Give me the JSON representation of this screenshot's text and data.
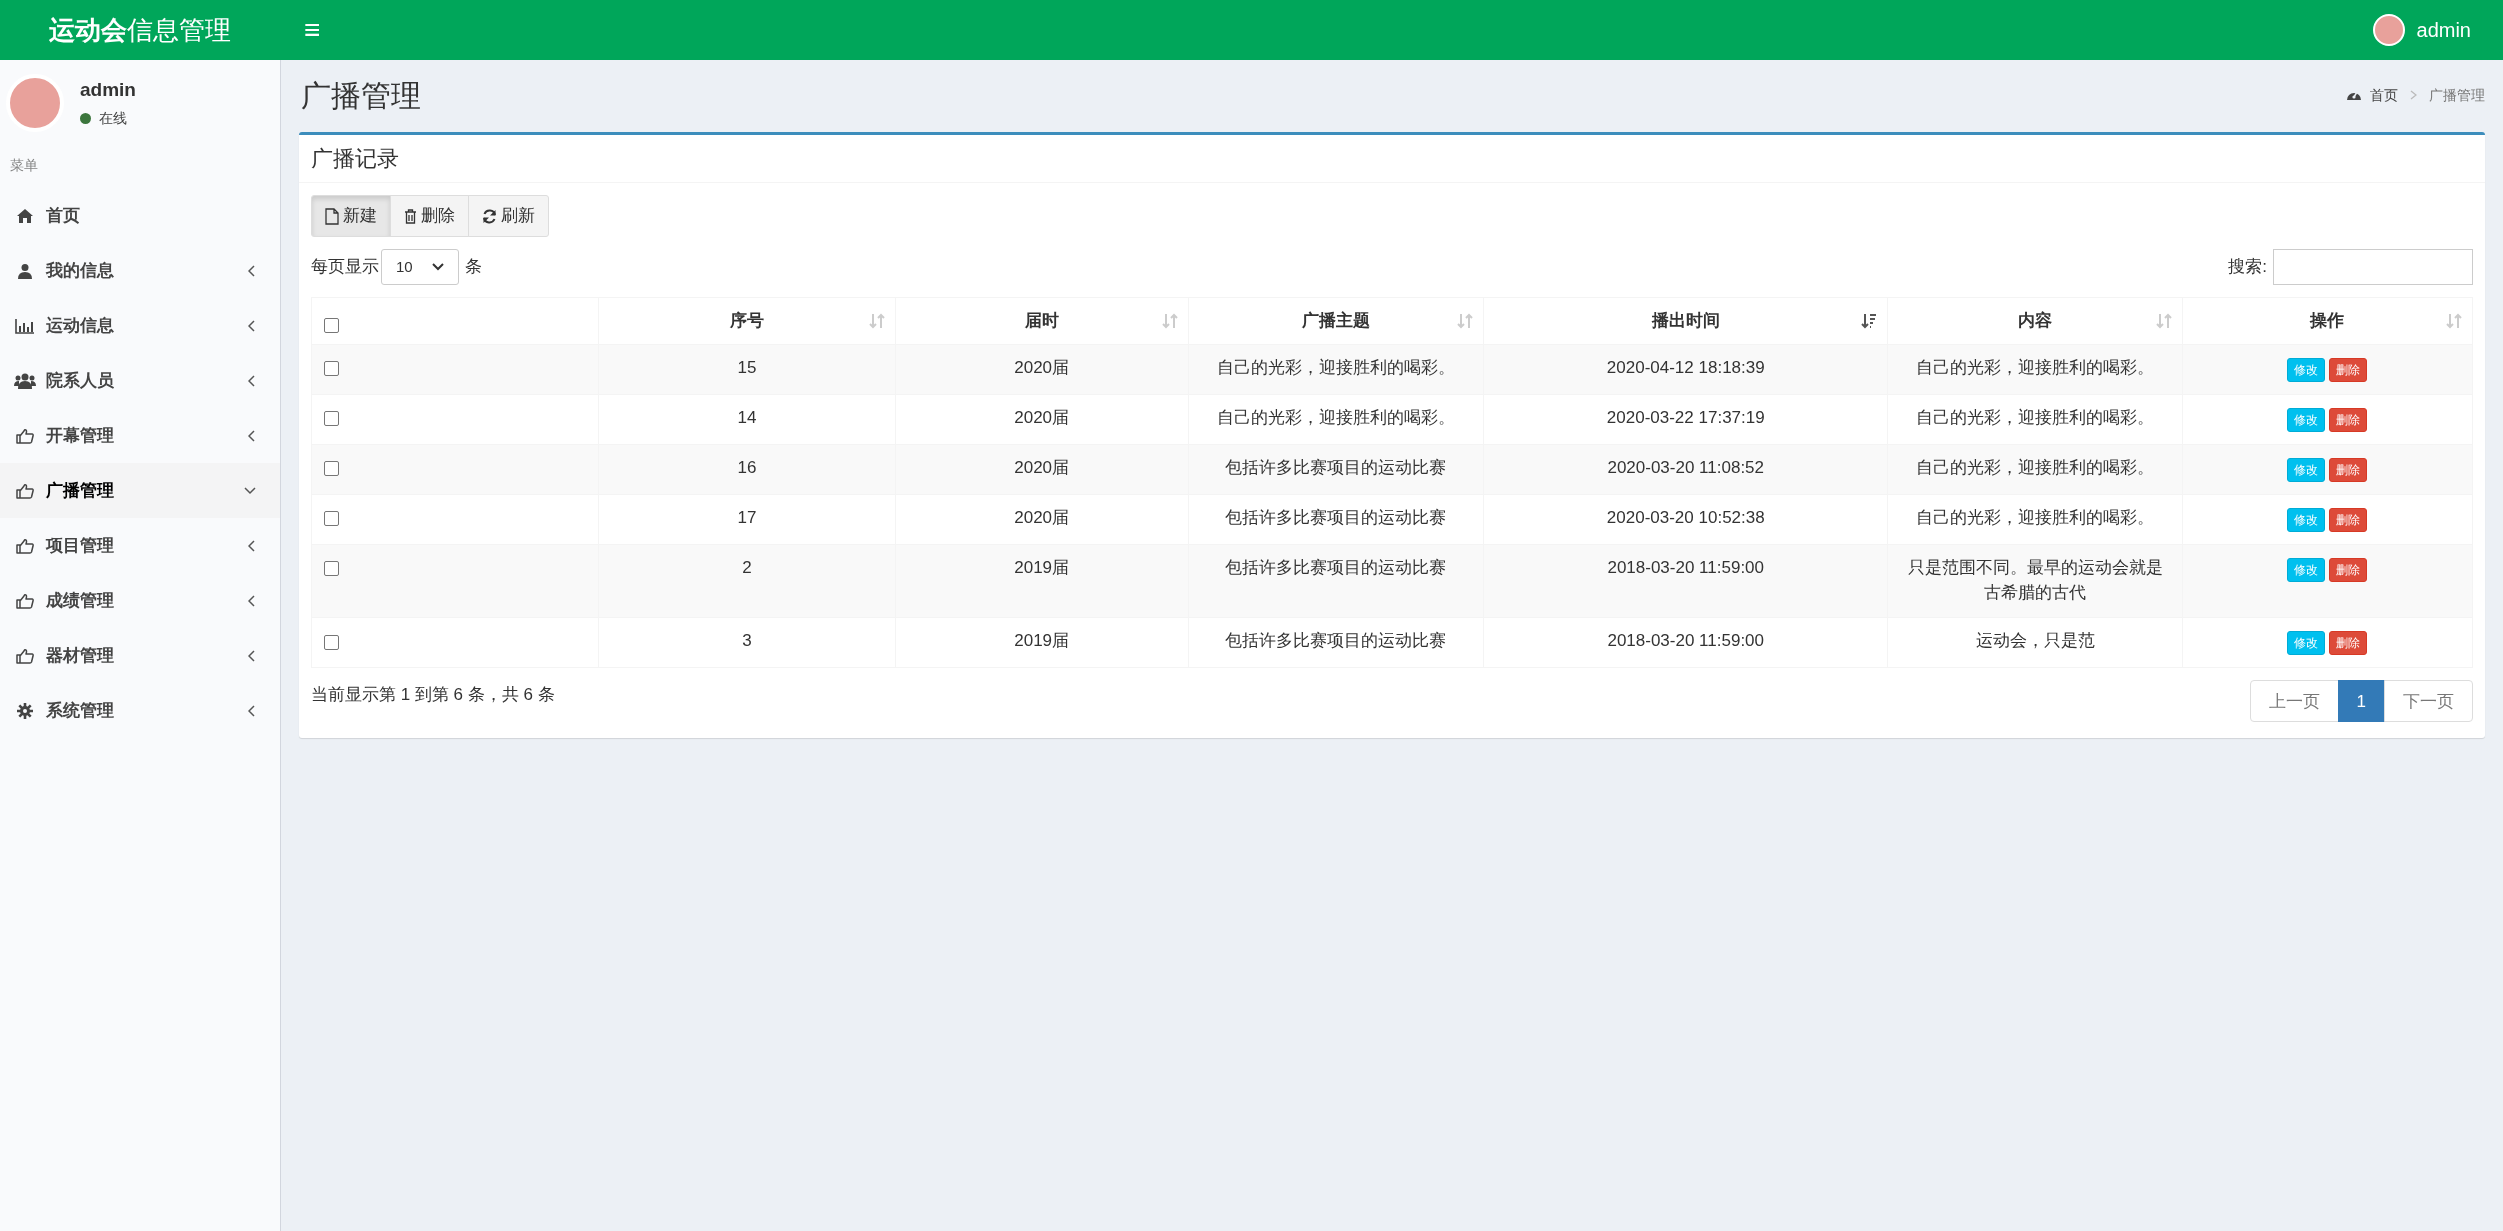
{
  "header": {
    "logo": "**运动会**信息管理",
    "menu_toggle": "≡",
    "user": "admin"
  },
  "sidebar": {
    "user": {
      "name": "admin",
      "status": "在线"
    },
    "section": "菜单",
    "items": [
      {
        "label": "首页",
        "selected": false
      },
      {
        "label": "我的信息",
        "selected": false,
        "expanded": false
      },
      {
        "label": "运动信息",
        "selected": false,
        "expanded": false
      },
      {
        "label": "院系人员",
        "selected": false,
        "expanded": false
      },
      {
        "label": "开幕管理",
        "selected": false,
        "expanded": false
      },
      {
        "label": "广播管理",
        "selected": true,
        "expanded": true
      },
      {
        "label": "项目管理",
        "selected": false,
        "expanded": false
      },
      {
        "label": "成绩管理",
        "selected": false,
        "expanded": false
      },
      {
        "label": "器材管理",
        "selected": false,
        "expanded": false
      },
      {
        "label": "系统管理",
        "selected": false,
        "expanded": false
      }
    ]
  },
  "page": {
    "title": "广播管理",
    "breadcrumb": [
      "首页",
      "广播管理"
    ]
  },
  "box": {
    "title": "广播记录",
    "toolbar": [
      {
        "label": "新建",
        "kind": "new",
        "selected": true
      },
      {
        "label": "删除",
        "kind": "delete",
        "selected": false
      },
      {
        "label": "刷新",
        "kind": "refresh",
        "selected": false
      }
    ],
    "length": {
      "before": "每页显示",
      "value": "10",
      "after": "条"
    },
    "search": {
      "label": "搜索:"
    },
    "table": {
      "select_all": {
        "checked": false
      },
      "columns": [
        {
          "label": "序号",
          "sorted_descending": false
        },
        {
          "label": "届时",
          "sorted_descending": false
        },
        {
          "label": "广播主题",
          "sorted_descending": false
        },
        {
          "label": "播出时间",
          "sorted_descending": true
        },
        {
          "label": "内容",
          "sorted_descending": false
        },
        {
          "label": "操作",
          "sorted_descending": false
        }
      ],
      "rows": [
        {
          "checked": false,
          "cells": [
            "15",
            "2020届",
            "自己的光彩，迎接胜利的喝彩。",
            "2020-04-12 18:18:39",
            "自己的光彩，迎接胜利的喝彩。"
          ],
          "actions": [
            {
              "label": "修改",
              "kind": "edit"
            },
            {
              "label": "删除",
              "kind": "delete"
            }
          ]
        },
        {
          "checked": false,
          "cells": [
            "14",
            "2020届",
            "自己的光彩，迎接胜利的喝彩。",
            "2020-03-22 17:37:19",
            "自己的光彩，迎接胜利的喝彩。"
          ],
          "actions": [
            {
              "label": "修改",
              "kind": "edit"
            },
            {
              "label": "删除",
              "kind": "delete"
            }
          ]
        },
        {
          "checked": false,
          "cells": [
            "16",
            "2020届",
            "包括许多比赛项目的运动比赛",
            "2020-03-20 11:08:52",
            "自己的光彩，迎接胜利的喝彩。"
          ],
          "actions": [
            {
              "label": "修改",
              "kind": "edit"
            },
            {
              "label": "删除",
              "kind": "delete"
            }
          ]
        },
        {
          "checked": false,
          "cells": [
            "17",
            "2020届",
            "包括许多比赛项目的运动比赛",
            "2020-03-20 10:52:38",
            "自己的光彩，迎接胜利的喝彩。"
          ],
          "actions": [
            {
              "label": "修改",
              "kind": "edit"
            },
            {
              "label": "删除",
              "kind": "delete"
            }
          ]
        },
        {
          "checked": false,
          "cells": [
            "2",
            "2019届",
            "包括许多比赛项目的运动比赛",
            "2018-03-20 11:59:00",
            "只是范围不同。最早的运动会就是古希腊的古代"
          ],
          "actions": [
            {
              "label": "修改",
              "kind": "edit"
            },
            {
              "label": "删除",
              "kind": "delete"
            }
          ]
        },
        {
          "checked": false,
          "cells": [
            "3",
            "2019届",
            "包括许多比赛项目的运动比赛",
            "2018-03-20 11:59:00",
            "运动会，只是范"
          ],
          "actions": [
            {
              "label": "修改",
              "kind": "edit"
            },
            {
              "label": "删除",
              "kind": "delete"
            }
          ]
        }
      ]
    },
    "info": "当前显示第 1 到第 6 条，共 6 条",
    "pagination": [
      {
        "label": "上一页",
        "selected": false
      },
      {
        "label": "1",
        "selected": true
      },
      {
        "label": "下一页",
        "selected": false
      }
    ]
  }
}
